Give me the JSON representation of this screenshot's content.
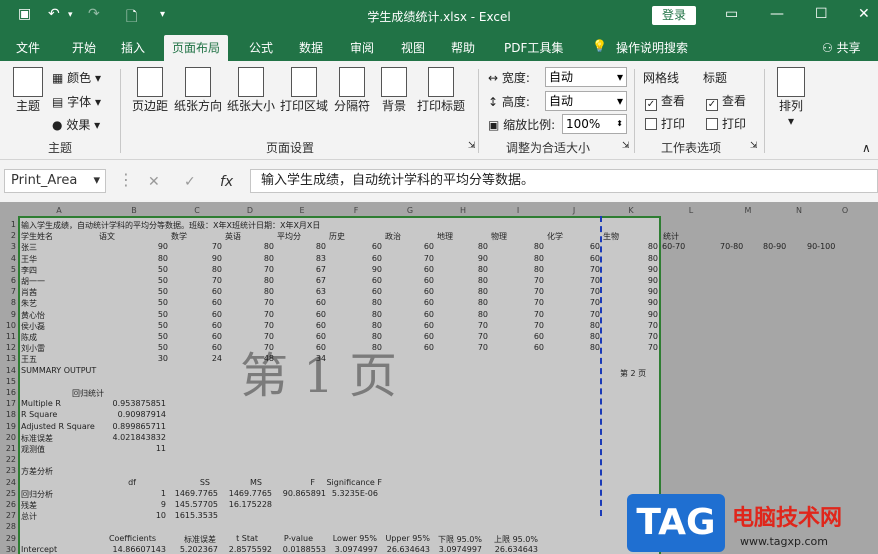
{
  "titlebar": {
    "title": "学生成绩统计.xlsx  -  Excel",
    "login": "登录"
  },
  "tabs": [
    "文件",
    "开始",
    "插入",
    "页面布局",
    "公式",
    "数据",
    "审阅",
    "视图",
    "帮助",
    "PDF工具集",
    "操作说明搜索",
    "共享"
  ],
  "ribbon": {
    "theme": {
      "themes": "主题",
      "colors": "颜色",
      "fonts": "字体",
      "effects": "效果",
      "group": "主题"
    },
    "pagesetup": {
      "margins": "页边距",
      "orientation": "纸张方向",
      "size": "纸张大小",
      "print_area": "打印区域",
      "breaks": "分隔符",
      "background": "背景",
      "print_titles": "打印标题",
      "group": "页面设置"
    },
    "scale": {
      "width_label": "宽度:",
      "width_value": "自动",
      "height_label": "高度:",
      "height_value": "自动",
      "scale_label": "缩放比例:",
      "scale_value": "100%",
      "group": "调整为合适大小"
    },
    "options": {
      "gridlines": "网格线",
      "headings": "标题",
      "view": "查看",
      "print": "打印",
      "group": "工作表选项"
    },
    "arrange": {
      "label": "排列"
    }
  },
  "formula": {
    "name_box": "Print_Area",
    "fx": "fx",
    "content": "输入学生成绩，自动统计学科的平均分等数据。"
  },
  "columns": [
    "A",
    "B",
    "C",
    "D",
    "E",
    "F",
    "G",
    "H",
    "I",
    "J",
    "K",
    "L",
    "M",
    "N",
    "O"
  ],
  "rows": [
    "1",
    "2",
    "3",
    "4",
    "5",
    "6",
    "7",
    "8",
    "9",
    "10",
    "11",
    "12",
    "13",
    "14",
    "15",
    "16",
    "17",
    "18",
    "19",
    "20",
    "21",
    "22",
    "23",
    "24",
    "25",
    "26",
    "27",
    "28",
    "29",
    "30"
  ],
  "sheet": {
    "row1": "输入学生成绩，自动统计学科的平均分等数据。班级：X年X班统计日期：X年X月X日",
    "headers": [
      "学生姓名",
      "语文",
      "数学",
      "英语",
      "平均分",
      "历史",
      "政治",
      "地理",
      "物理",
      "化学",
      "生物",
      "统计"
    ],
    "students": [
      [
        "张三",
        "90",
        "70",
        "80",
        "80",
        "60",
        "60",
        "80",
        "80",
        "60",
        "80"
      ],
      [
        "王华",
        "80",
        "90",
        "80",
        "83",
        "60",
        "70",
        "90",
        "80",
        "60",
        "80"
      ],
      [
        "李四",
        "50",
        "80",
        "70",
        "67",
        "90",
        "60",
        "80",
        "80",
        "70",
        "90"
      ],
      [
        "胡一一",
        "50",
        "70",
        "80",
        "67",
        "60",
        "60",
        "80",
        "70",
        "70",
        "90"
      ],
      [
        "肖茜",
        "50",
        "60",
        "80",
        "63",
        "60",
        "60",
        "80",
        "70",
        "70",
        "90"
      ],
      [
        "朱艺",
        "50",
        "60",
        "70",
        "60",
        "80",
        "60",
        "80",
        "70",
        "70",
        "90"
      ],
      [
        "黄心怡",
        "50",
        "60",
        "70",
        "60",
        "80",
        "60",
        "80",
        "70",
        "70",
        "90"
      ],
      [
        "侯小磊",
        "50",
        "60",
        "70",
        "60",
        "80",
        "60",
        "70",
        "70",
        "80",
        "70"
      ],
      [
        "陈成",
        "50",
        "60",
        "70",
        "60",
        "80",
        "60",
        "70",
        "60",
        "80",
        "70"
      ],
      [
        "刘小雷",
        "50",
        "60",
        "70",
        "60",
        "80",
        "60",
        "70",
        "60",
        "80",
        "70"
      ],
      [
        "王五",
        "30",
        "24",
        "48",
        "34",
        "",
        "",
        "",
        "",
        "",
        ""
      ]
    ],
    "stats_headers": [
      "60-70",
      "70-80",
      "80-90",
      "90-100"
    ],
    "watermark": "第 1 页",
    "page2": "第 2 页",
    "summary": "SUMMARY OUTPUT",
    "regstat": "回归统计",
    "reg": [
      [
        "Multiple R",
        "0.953875851"
      ],
      [
        "R Square",
        "0.90987914"
      ],
      [
        "Adjusted R Square",
        "0.899865711"
      ],
      [
        "标准误差",
        "4.021843832"
      ],
      [
        "观测值",
        "11"
      ]
    ],
    "anova_title": "方差分析",
    "anova_headers": [
      "df",
      "SS",
      "MS",
      "F",
      "Significance F"
    ],
    "anova": [
      [
        "回归分析",
        "1",
        "1469.7765",
        "1469.7765",
        "90.865891",
        "5.3235E-06"
      ],
      [
        "残差",
        "9",
        "145.57705",
        "16.175228",
        "",
        ""
      ],
      [
        "总计",
        "10",
        "1615.3535",
        "",
        "",
        ""
      ]
    ],
    "coef_headers": [
      "Coefficients",
      "标准误差",
      "t Stat",
      "P-value",
      "Lower 95%",
      "Upper 95%",
      "下限 95.0%",
      "上限 95.0%"
    ],
    "coef": [
      "Intercept",
      "14.86607143",
      "5.202367",
      "2.8575592",
      "0.0188553",
      "3.0974997",
      "26.634643",
      "3.0974997",
      "26.634643"
    ]
  },
  "logo": {
    "tag": "TAG",
    "name": "电脑技术网",
    "url": "www.tagxp.com"
  }
}
